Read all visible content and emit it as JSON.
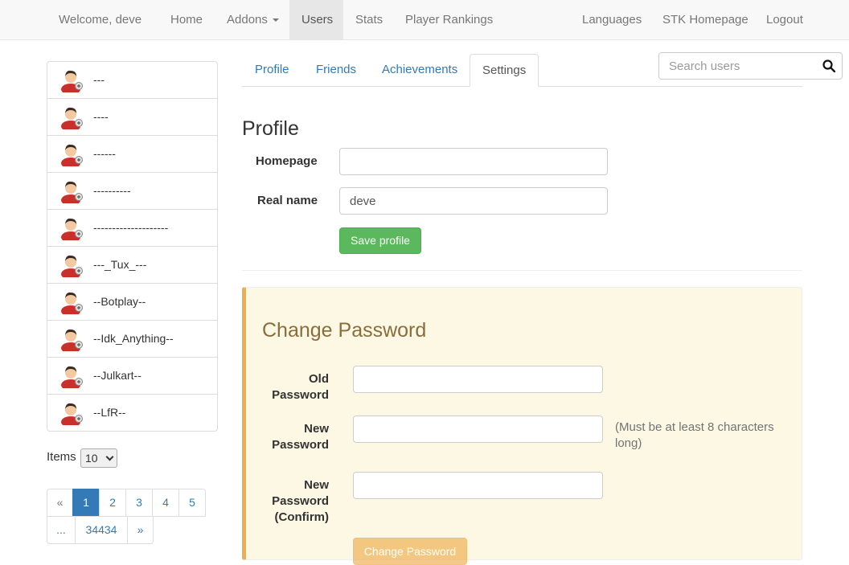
{
  "navbar": {
    "welcome": "Welcome, deve",
    "home": "Home",
    "addons": "Addons",
    "users": "Users",
    "stats": "Stats",
    "rankings": "Player Rankings",
    "languages": "Languages",
    "stk_homepage": "STK Homepage",
    "logout": "Logout"
  },
  "sidebar": {
    "users": [
      "---",
      "----",
      "------",
      "----------",
      "--------------------",
      "---_Tux_---",
      "--Botplay--",
      "--Idk_Anything--",
      "--Julkart--",
      "--LfR--"
    ],
    "items_label": "Items",
    "items_value": "10"
  },
  "pagination": {
    "prev": "«",
    "pages": [
      "1",
      "2",
      "3",
      "4",
      "5"
    ],
    "ellipsis": "...",
    "last": "34434",
    "next": "»",
    "active": "1"
  },
  "tabs": [
    "Profile",
    "Friends",
    "Achievements",
    "Settings"
  ],
  "active_tab": "Settings",
  "search": {
    "placeholder": "Search users"
  },
  "profile": {
    "heading": "Profile",
    "homepage_label": "Homepage",
    "homepage_value": "",
    "realname_label": "Real name",
    "realname_value": "deve",
    "save_label": "Save profile"
  },
  "password": {
    "heading": "Change Password",
    "old_label": "Old Password",
    "new_label": "New Password",
    "confirm_label": "New Password (Confirm)",
    "help": "(Must be at least 8 characters long)",
    "button_label": "Change Password"
  },
  "colors": {
    "link": "#337ab7",
    "success": "#5cb85c",
    "warning": "#f0ad4e",
    "warning_bg": "#fcf8e3",
    "warning_text": "#8a6d3b"
  }
}
